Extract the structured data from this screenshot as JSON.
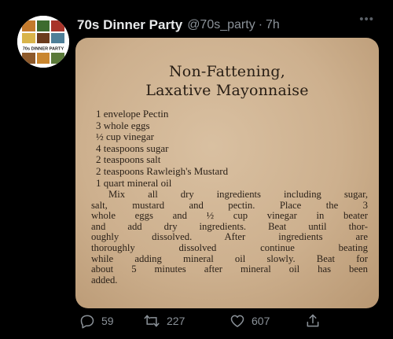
{
  "header": {
    "display_name": "70s Dinner Party",
    "handle": "@70s_party",
    "separator": "·",
    "time": "7h",
    "more_icon": "more-dots-icon"
  },
  "avatar": {
    "label": "70s DINNER PARTY"
  },
  "recipe": {
    "title_line1": "Non-Fattening,",
    "title_line2": "Laxative Mayonnaise",
    "ingredients": [
      "1 envelope Pectin",
      "3 whole eggs",
      "½ cup vinegar",
      "4 teaspoons sugar",
      "2 teaspoons salt",
      "2 teaspoons Rawleigh's Mustard",
      "1 quart mineral oil"
    ],
    "instructions_lines": [
      "Mix all dry ingredients including sugar,",
      "salt, mustard and pectin. Place the 3",
      "whole eggs and ½ cup vinegar in beater",
      "and add dry ingredients. Beat until thor-",
      "oughly dissolved. After ingredients are",
      "thoroughly dissolved continue beating",
      "while adding mineral oil slowly. Beat for",
      "about 5 minutes after mineral oil has been",
      "added."
    ]
  },
  "actions": {
    "replies": "59",
    "retweets": "227",
    "likes": "607"
  },
  "colors": {
    "background": "#000000",
    "text_primary": "#e7e9ea",
    "text_secondary": "#8b9299",
    "card_paper": "#cdb08e",
    "ink": "#2b2118"
  }
}
